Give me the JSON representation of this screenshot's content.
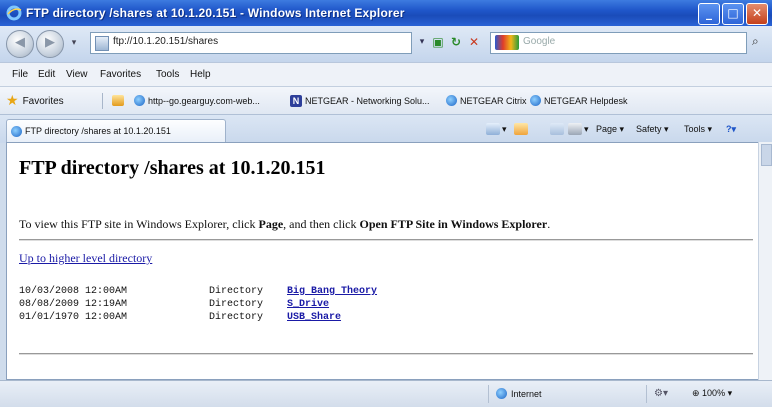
{
  "window": {
    "title": "FTP directory /shares at 10.1.20.151 - Windows Internet Explorer"
  },
  "address_bar": {
    "url": "ftp://10.1.20.151/shares",
    "search_placeholder": "Google"
  },
  "menu": [
    "File",
    "Edit",
    "View",
    "Favorites",
    "Tools",
    "Help"
  ],
  "favorites_bar": {
    "label": "Favorites",
    "items": [
      "http--go.gearguy.com-web...",
      "NETGEAR - Networking Solu...",
      "NETGEAR Citrix",
      "NETGEAR Helpdesk"
    ]
  },
  "tab": {
    "title": "FTP directory /shares at 10.1.20.151"
  },
  "command_bar": {
    "page": "Page",
    "safety": "Safety",
    "tools": "Tools"
  },
  "page": {
    "heading": "FTP directory /shares at 10.1.20.151",
    "instruction_prefix": "To view this FTP site in Windows Explorer, click ",
    "instruction_page": "Page",
    "instruction_mid": ", and then click ",
    "instruction_open": "Open FTP Site in Windows Explorer",
    "instruction_suffix": ".",
    "up_link": "Up to higher level directory",
    "entries": [
      {
        "date": "10/03/2008 12:00AM",
        "type": "Directory",
        "name": "Big Bang Theory"
      },
      {
        "date": "08/08/2009 12:19AM",
        "type": "Directory",
        "name": "S_Drive"
      },
      {
        "date": "01/01/1970 12:00AM",
        "type": "Directory",
        "name": "USB_Share"
      }
    ]
  },
  "status_bar": {
    "zone": "Internet",
    "zoom": "100%"
  },
  "colors": {
    "titlebar": "#1f56c9",
    "link": "#1a1aa6",
    "chrome": "#cfdcec"
  }
}
